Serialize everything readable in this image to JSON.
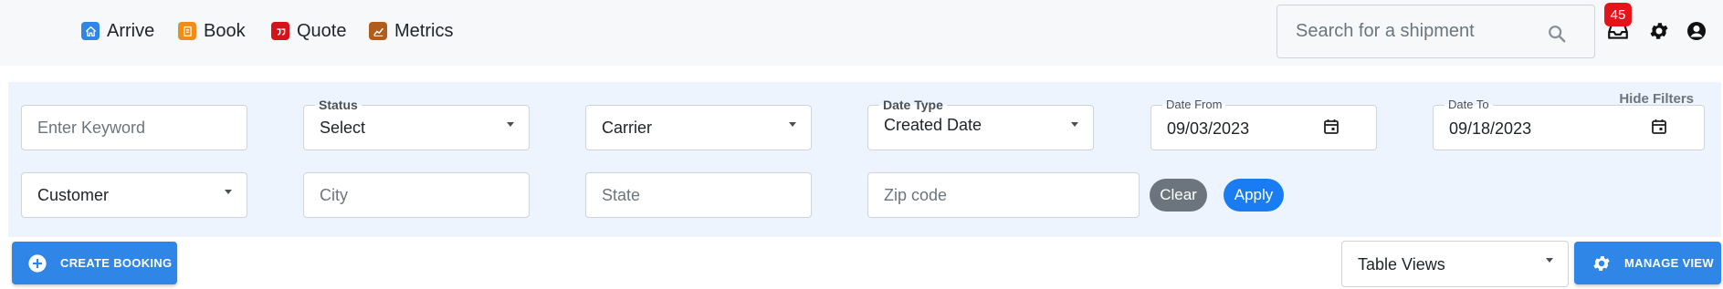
{
  "nav": {
    "items": [
      {
        "label": "Arrive",
        "icon": "home-icon",
        "color": "#2f86e6"
      },
      {
        "label": "Book",
        "icon": "book-icon",
        "color": "#f08c1e"
      },
      {
        "label": "Quote",
        "icon": "quote-icon",
        "color": "#d4141b"
      },
      {
        "label": "Metrics",
        "icon": "chart-icon",
        "color": "#b15b1c"
      }
    ]
  },
  "search": {
    "placeholder": "Search for a shipment"
  },
  "notifications": {
    "count": "45",
    "badge_color": "#e5141b"
  },
  "filters": {
    "hide_label": "Hide Filters",
    "keyword": {
      "placeholder": "Enter Keyword"
    },
    "status": {
      "label": "Status",
      "value": "Select"
    },
    "carrier": {
      "value": "Carrier"
    },
    "date_type": {
      "label": "Date Type",
      "value": "Created Date"
    },
    "date_from": {
      "label": "Date From",
      "value": "09/03/2023"
    },
    "date_to": {
      "label": "Date To",
      "value": "09/18/2023"
    },
    "customer": {
      "value": "Customer"
    },
    "city": {
      "placeholder": "City"
    },
    "state": {
      "placeholder": "State"
    },
    "zip": {
      "placeholder": "Zip code"
    },
    "clear_label": "Clear",
    "apply_label": "Apply"
  },
  "actions": {
    "create_booking_label": "CREATE BOOKING",
    "table_views_value": "Table Views",
    "manage_view_label": "MANAGE VIEW"
  },
  "colors": {
    "primary": "#2f86e6",
    "secondary": "#6c757d",
    "panel_bg": "#eef4fd"
  }
}
